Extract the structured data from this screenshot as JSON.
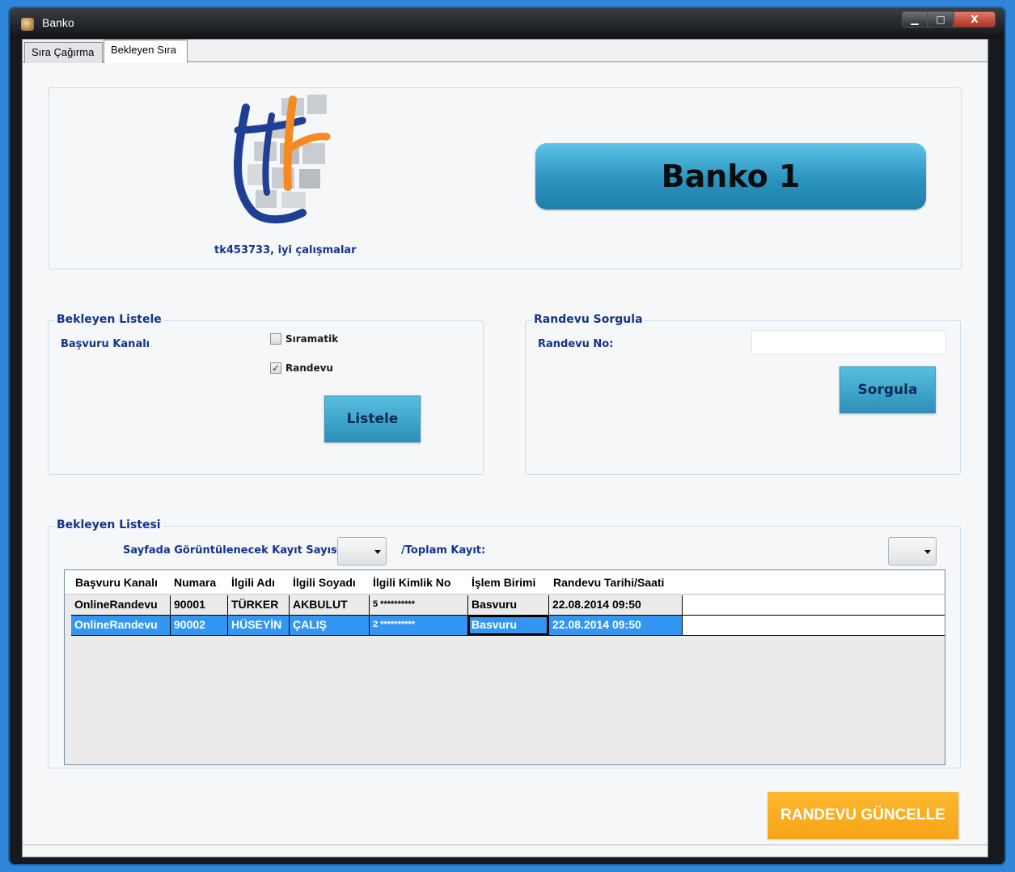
{
  "window": {
    "title": "Banko",
    "minimize": "▁",
    "maximize": "□",
    "close": "X"
  },
  "tabs": [
    {
      "label": "Sıra Çağırma"
    },
    {
      "label": "Bekleyen Sıra"
    }
  ],
  "header": {
    "logo": "tk",
    "greeting": "tk453733, iyi çalışmalar",
    "banko_label": "Banko 1"
  },
  "bekleyen_listele": {
    "title": "Bekleyen Listele",
    "channel_label": "Başvuru Kanalı",
    "options": [
      {
        "label": "Sıramatik",
        "checked": false
      },
      {
        "label": "Randevu",
        "checked": true
      }
    ],
    "button": "Listele"
  },
  "randevu_sorgula": {
    "title": "Randevu Sorgula",
    "field_label": "Randevu No:",
    "value": "",
    "button": "Sorgula"
  },
  "bekleyen_listesi": {
    "title": "Bekleyen Listesi",
    "page_size_label": "Sayfada Görüntülenecek Kayıt Sayısı:",
    "total_label": "/Toplam Kayıt:",
    "columns": [
      "Başvuru Kanalı",
      "Numara",
      "İlgili Adı",
      "İlgili Soyadı",
      "İlgili Kimlik No",
      "İşlem Birimi",
      "Randevu Tarihi/Saati"
    ],
    "rows": [
      [
        "OnlineRandevu",
        "90001",
        "TÜRKER",
        "AKBULUT",
        "5 **********",
        "Basvuru",
        "22.08.2014 09:50"
      ],
      [
        "OnlineRandevu",
        "90002",
        "HÜSEYİN",
        "ÇALIŞ",
        "2 **********",
        "Basvuru",
        "22.08.2014 09:50"
      ]
    ],
    "selected_row": 1
  },
  "actions": {
    "update_button": "RANDEVU GÜNCELLE"
  },
  "colors": {
    "accent_blue": "#2a93be",
    "selection": "#3397f2",
    "orange": "#f5a414",
    "label_blue": "#13348c"
  }
}
